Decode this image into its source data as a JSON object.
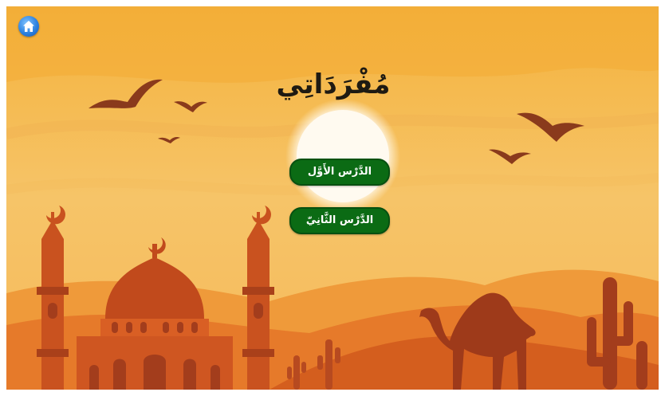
{
  "app": {
    "title": "مُفْرَدَاتِي",
    "home_icon": "home-icon"
  },
  "lessons": [
    {
      "label": "الدَّرْس الأَوَّل"
    },
    {
      "label": "الدَّرْس الثَّانِيّ"
    }
  ],
  "colors": {
    "button_green": "#0b6b14",
    "sky_top": "#f5b43a",
    "sky_bottom": "#f2c76a",
    "dune": "#e0702a",
    "silhouette": "#a33d1c",
    "mosque": "#c8501f"
  }
}
